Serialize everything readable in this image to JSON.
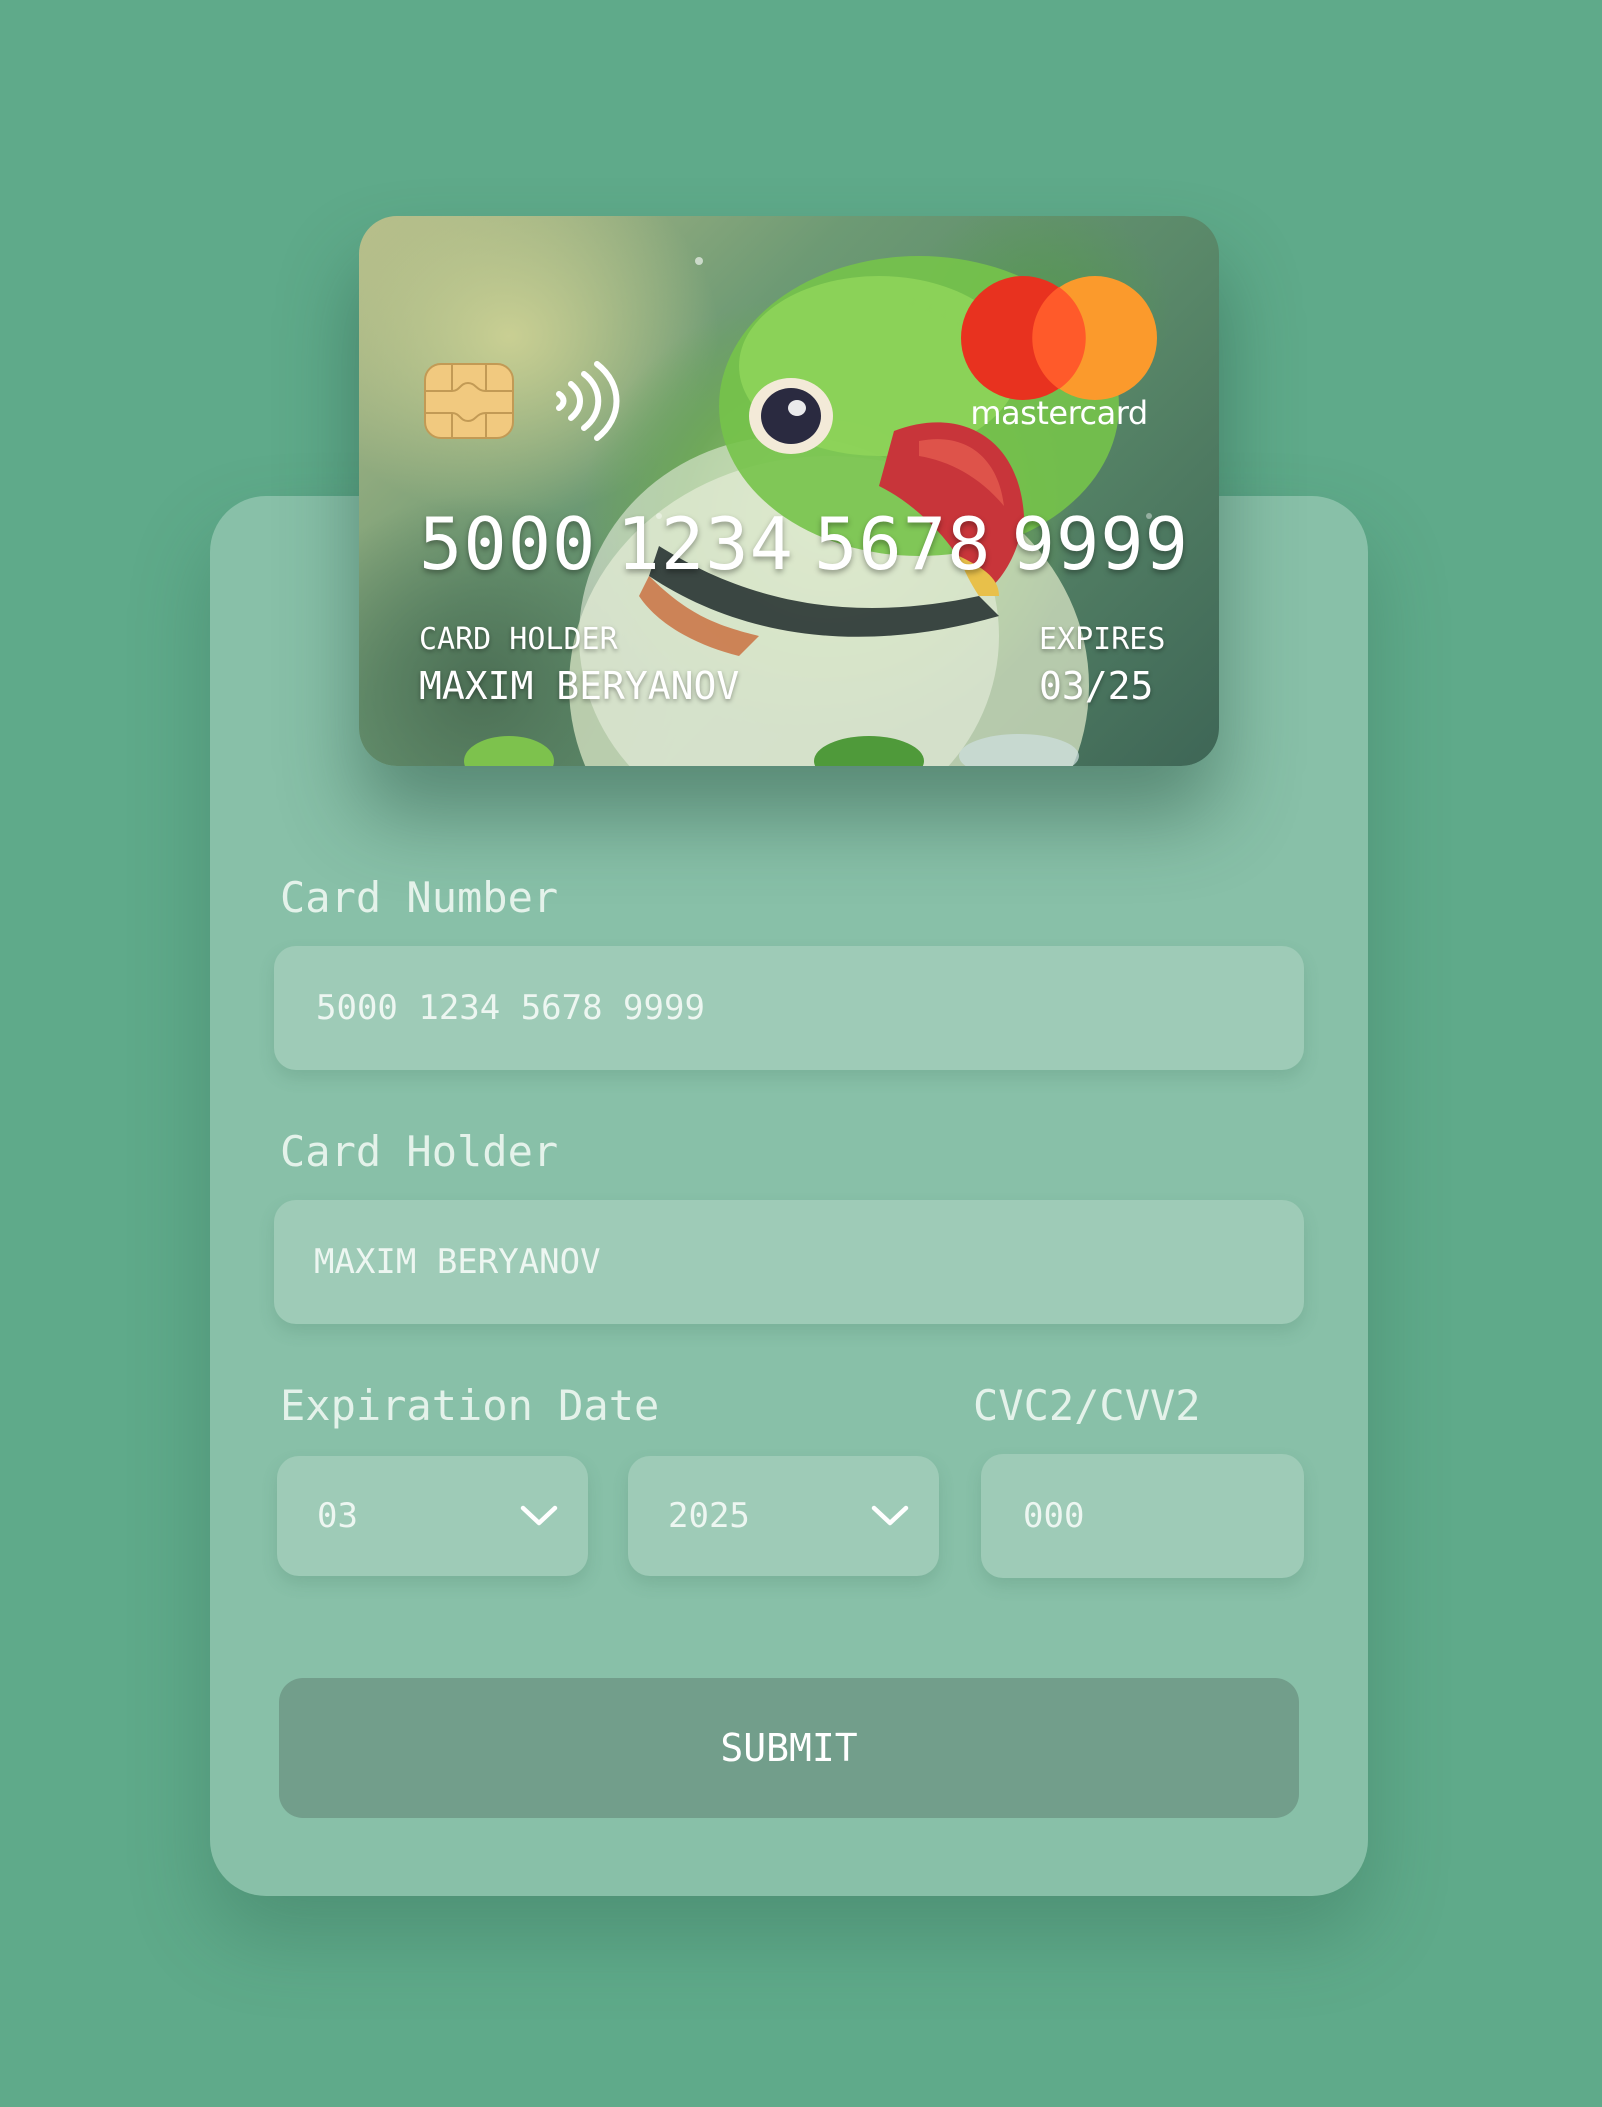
{
  "card": {
    "number_groups": [
      "5000",
      "1234",
      "5678",
      "9999"
    ],
    "holder_label": "CARD HOLDER",
    "holder_value": "MAXIM BERYANOV",
    "expires_label": "EXPIRES",
    "expires_value": "03/25",
    "brand": "mastercard",
    "icons": [
      "chip-icon",
      "contactless-icon",
      "mastercard-logo"
    ]
  },
  "form": {
    "card_number_label": "Card Number",
    "card_number_value": "5000 1234 5678 9999",
    "card_holder_label": "Card Holder",
    "card_holder_value": "MAXIM BERYANOV",
    "expiration_label": "Expiration Date",
    "month_value": "03",
    "year_value": "2025",
    "cvc_label": "CVC2/CVV2",
    "cvc_placeholder": "000",
    "submit_label": "SUBMIT"
  },
  "colors": {
    "background": "#5faa8a",
    "panel": "#88c0a8",
    "field": "#9ecbb7",
    "button": "#729e8b",
    "mastercard_red": "#e8321f",
    "mastercard_orange": "#fb9a2c"
  }
}
